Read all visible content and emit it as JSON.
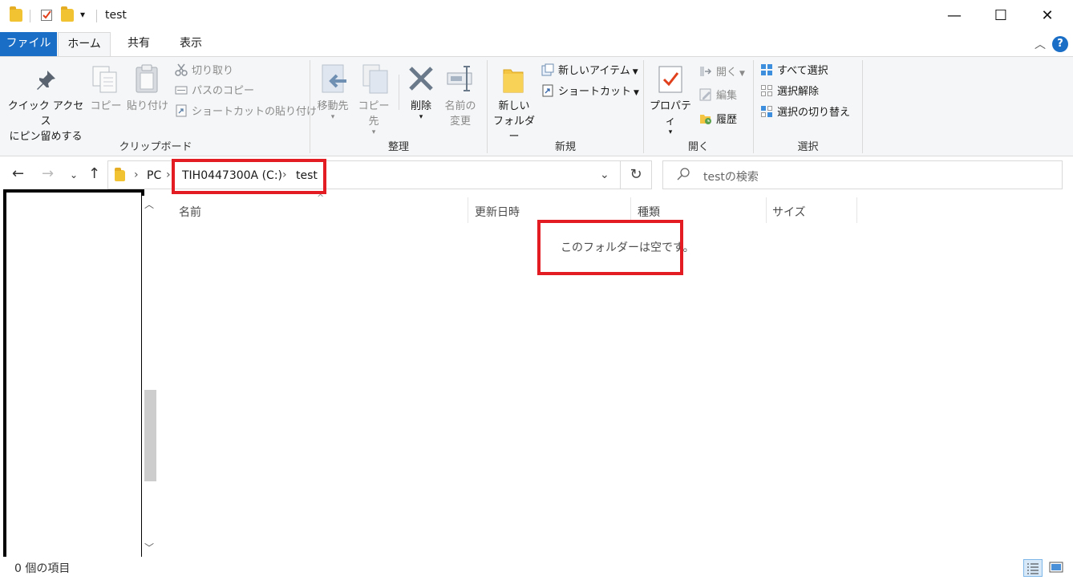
{
  "titlebar": {
    "title": "test",
    "qa_dropdown": "▾",
    "minimize": "—",
    "maximize": "☐",
    "close": "✕"
  },
  "tabs": [
    {
      "label": "ファイル"
    },
    {
      "label": "ホーム"
    },
    {
      "label": "共有"
    },
    {
      "label": "表示"
    }
  ],
  "ribbon": {
    "clipboard": {
      "pin_line1": "クイック アクセス",
      "pin_line2": "にピン留めする",
      "copy": "コピー",
      "paste": "貼り付け",
      "cut": "切り取り",
      "copy_path": "パスのコピー",
      "paste_shortcut": "ショートカットの貼り付け",
      "group": "クリップボード"
    },
    "organize": {
      "move_to": "移動先",
      "copy_to": "コピー先",
      "delete": "削除",
      "rename_line1": "名前の",
      "rename_line2": "変更",
      "group": "整理"
    },
    "new": {
      "new_folder_line1": "新しい",
      "new_folder_line2": "フォルダー",
      "new_item": "新しいアイテム",
      "shortcut": "ショートカット",
      "group": "新規"
    },
    "open": {
      "properties": "プロパティ",
      "open": "開く",
      "edit": "編集",
      "history": "履歴",
      "group": "開く"
    },
    "select": {
      "select_all": "すべて選択",
      "select_none": "選択解除",
      "invert": "選択の切り替え",
      "group": "選択"
    }
  },
  "address": {
    "crumbs": [
      "PC",
      "TIH0447300A (C:)",
      "test"
    ],
    "search_placeholder": "testの検索"
  },
  "columns": [
    "名前",
    "更新日時",
    "種類",
    "サイズ"
  ],
  "content": {
    "empty_message": "このフォルダーは空です。"
  },
  "status": {
    "item_count": "0 個の項目"
  },
  "colors": {
    "accent": "#1a6ec6",
    "annotation_red": "#e31b23"
  }
}
